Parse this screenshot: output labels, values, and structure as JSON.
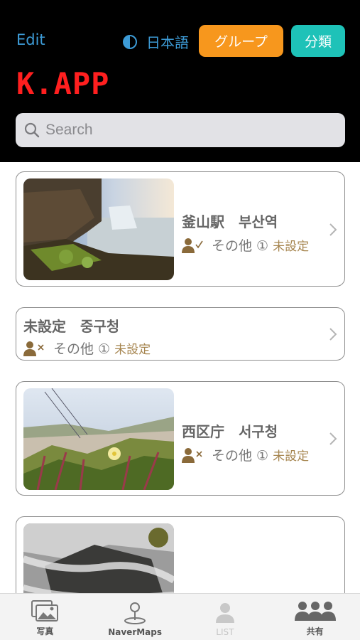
{
  "header": {
    "edit_label": "Edit",
    "language_label": "日本語",
    "group_button": "グループ",
    "classify_button": "分類",
    "brand": "K.APP"
  },
  "search": {
    "placeholder": "Search"
  },
  "items": [
    {
      "title": "釜山駅　부산역",
      "who": "その他 ①",
      "status": "未設定",
      "person_icon": "person-check-icon",
      "has_image": true
    },
    {
      "title": "未設定　중구청",
      "who": "その他 ①",
      "status": "未設定",
      "person_icon": "person-x-icon",
      "has_image": false
    },
    {
      "title": "西区庁　서구청",
      "who": "その他 ①",
      "status": "未設定",
      "person_icon": "person-x-icon",
      "has_image": true
    },
    {
      "title": "",
      "who": "",
      "status": "",
      "has_image": true
    }
  ],
  "tabs": [
    {
      "label": "写真",
      "icon": "photos-icon"
    },
    {
      "label": "NaverMaps",
      "icon": "map-pin-icon"
    },
    {
      "label": "LIST",
      "icon": "person-icon"
    },
    {
      "label": "共有",
      "icon": "group-icon"
    }
  ],
  "colors": {
    "header_bg": "#000000",
    "link_blue": "#3d9bd6",
    "group_orange": "#f7971d",
    "classify_teal": "#1ec2b8",
    "brand_red": "#ff1f1f",
    "status_gold": "#a6854f"
  }
}
